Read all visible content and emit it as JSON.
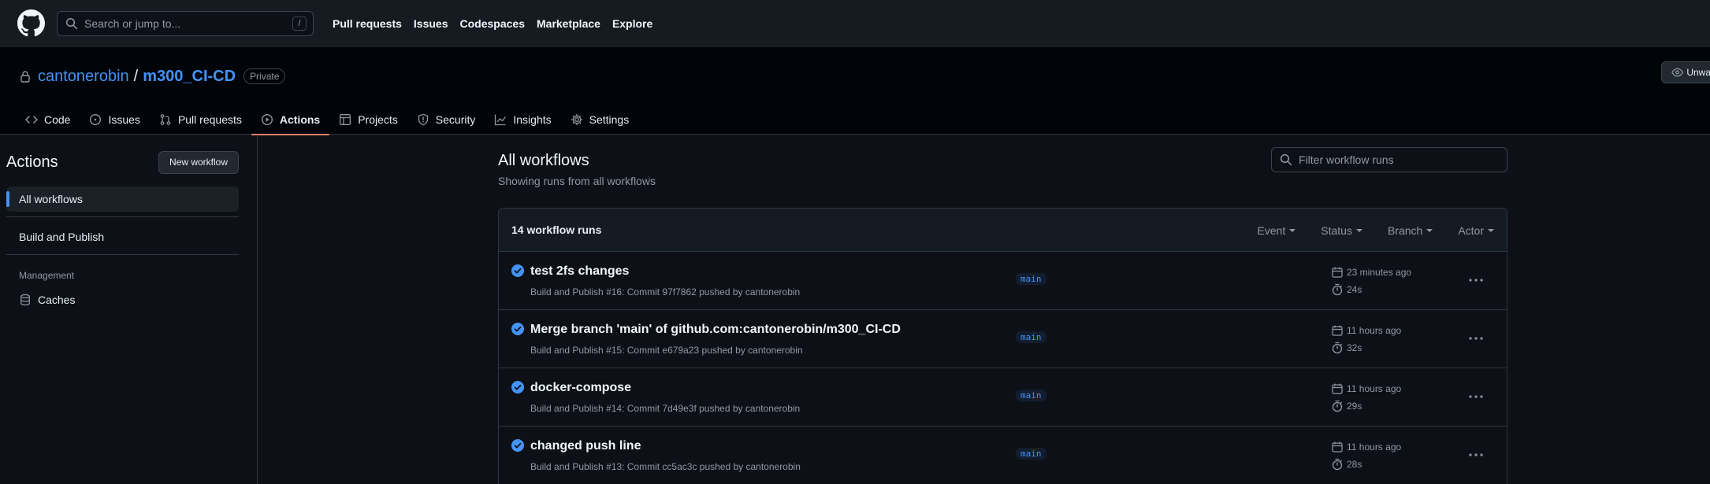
{
  "header": {
    "search_placeholder": "Search or jump to...",
    "search_shortcut": "/",
    "nav": [
      "Pull requests",
      "Issues",
      "Codespaces",
      "Marketplace",
      "Explore"
    ]
  },
  "repo": {
    "owner": "cantonerobin",
    "separator": "/",
    "name": "m300_CI-CD",
    "visibility": "Private",
    "unwatch_label": "Unwatch",
    "tabs": [
      {
        "label": "Code",
        "icon": "code-icon"
      },
      {
        "label": "Issues",
        "icon": "issue-icon"
      },
      {
        "label": "Pull requests",
        "icon": "pull-request-icon"
      },
      {
        "label": "Actions",
        "icon": "play-icon",
        "active": true
      },
      {
        "label": "Projects",
        "icon": "table-icon"
      },
      {
        "label": "Security",
        "icon": "shield-icon"
      },
      {
        "label": "Insights",
        "icon": "graph-icon"
      },
      {
        "label": "Settings",
        "icon": "gear-icon"
      }
    ]
  },
  "sidebar": {
    "title": "Actions",
    "new_workflow_label": "New workflow",
    "items": [
      {
        "label": "All workflows",
        "selected": true
      },
      {
        "label": "Build and Publish"
      }
    ],
    "management_heading": "Management",
    "management_items": [
      {
        "label": "Caches",
        "icon": "database-icon"
      }
    ]
  },
  "main": {
    "title": "All workflows",
    "subtitle": "Showing runs from all workflows",
    "filter_placeholder": "Filter workflow runs",
    "runs_count": "14 workflow runs",
    "filters": [
      "Event",
      "Status",
      "Branch",
      "Actor"
    ],
    "runs": [
      {
        "title": "test 2fs changes",
        "meta": "Build and Publish #16: Commit 97f7862 pushed by cantonerobin",
        "branch": "main",
        "time": "23 minutes ago",
        "duration": "24s"
      },
      {
        "title": "Merge branch 'main' of github.com:cantonerobin/m300_CI-CD",
        "meta": "Build and Publish #15: Commit e679a23 pushed by cantonerobin",
        "branch": "main",
        "time": "11 hours ago",
        "duration": "32s"
      },
      {
        "title": "docker-compose",
        "meta": "Build and Publish #14: Commit 7d49e3f pushed by cantonerobin",
        "branch": "main",
        "time": "11 hours ago",
        "duration": "29s"
      },
      {
        "title": "changed push line",
        "meta": "Build and Publish #13: Commit cc5ac3c pushed by cantonerobin",
        "branch": "main",
        "time": "11 hours ago",
        "duration": "28s"
      }
    ]
  },
  "colors": {
    "success": "#4493f8",
    "accent_underline": "#f78166",
    "link": "#4493f8"
  }
}
